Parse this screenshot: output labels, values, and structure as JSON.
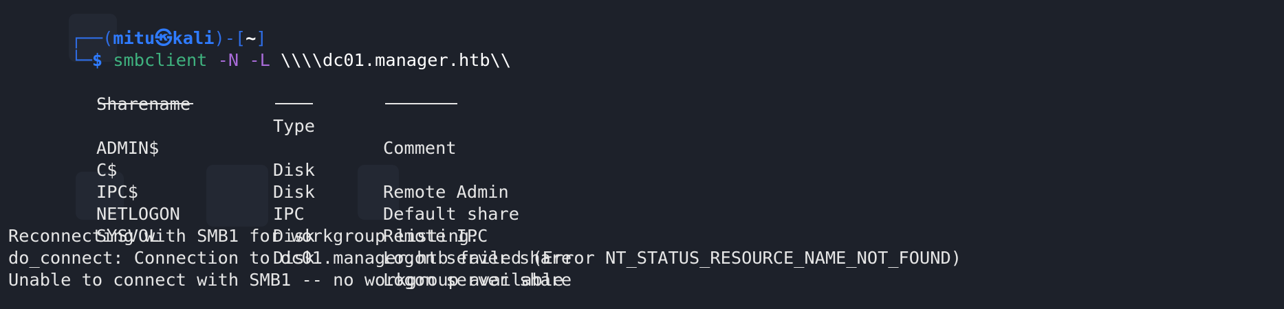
{
  "prompt": {
    "box_top": "┌──(",
    "user": "mitu",
    "at_glyph": "㉿",
    "host": "kali",
    "bracket_mid": ")-[",
    "dir": "~",
    "bracket_end": "]",
    "box_bottom": "└─",
    "dollar": "$"
  },
  "command": {
    "program": "smbclient",
    "flag_n": "-N",
    "flag_l": "-L",
    "target": "\\\\\\\\dc01.manager.htb\\\\"
  },
  "share_table": {
    "headers": {
      "name": "Sharename",
      "type": "Type",
      "comment": "Comment"
    },
    "rows": [
      {
        "name": "ADMIN$",
        "type": "Disk",
        "comment": "Remote Admin"
      },
      {
        "name": "C$",
        "type": "Disk",
        "comment": "Default share"
      },
      {
        "name": "IPC$",
        "type": "IPC",
        "comment": "Remote IPC"
      },
      {
        "name": "NETLOGON",
        "type": "Disk",
        "comment": "Logon server share"
      },
      {
        "name": "SYSVOL",
        "type": "Disk",
        "comment": "Logon server share"
      }
    ]
  },
  "output": {
    "line1": "Reconnecting with SMB1 for workgroup listing.",
    "line2": "do_connect: Connection to dc01.manager.htb failed (Error NT_STATUS_RESOURCE_NAME_NOT_FOUND)",
    "line3": "Unable to connect with SMB1 -- no workgroup available"
  },
  "colors": {
    "background": "#1d212a",
    "prompt_blue": "#2f7bff",
    "command_green": "#3fb27f",
    "flag_purple": "#a86bd8",
    "text": "#e6e6e6"
  }
}
